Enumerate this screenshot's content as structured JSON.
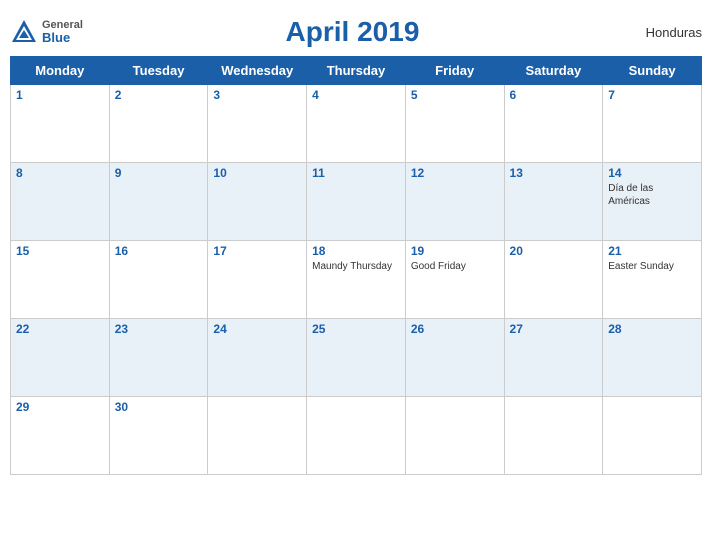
{
  "header": {
    "logo": {
      "general": "General",
      "blue": "Blue"
    },
    "title": "April 2019",
    "country": "Honduras"
  },
  "weekdays": [
    "Monday",
    "Tuesday",
    "Wednesday",
    "Thursday",
    "Friday",
    "Saturday",
    "Sunday"
  ],
  "weeks": [
    [
      {
        "date": "1",
        "holiday": ""
      },
      {
        "date": "2",
        "holiday": ""
      },
      {
        "date": "3",
        "holiday": ""
      },
      {
        "date": "4",
        "holiday": ""
      },
      {
        "date": "5",
        "holiday": ""
      },
      {
        "date": "6",
        "holiday": ""
      },
      {
        "date": "7",
        "holiday": ""
      }
    ],
    [
      {
        "date": "8",
        "holiday": ""
      },
      {
        "date": "9",
        "holiday": ""
      },
      {
        "date": "10",
        "holiday": ""
      },
      {
        "date": "11",
        "holiday": ""
      },
      {
        "date": "12",
        "holiday": ""
      },
      {
        "date": "13",
        "holiday": ""
      },
      {
        "date": "14",
        "holiday": "Día de las Américas"
      }
    ],
    [
      {
        "date": "15",
        "holiday": ""
      },
      {
        "date": "16",
        "holiday": ""
      },
      {
        "date": "17",
        "holiday": ""
      },
      {
        "date": "18",
        "holiday": "Maundy Thursday"
      },
      {
        "date": "19",
        "holiday": "Good Friday"
      },
      {
        "date": "20",
        "holiday": ""
      },
      {
        "date": "21",
        "holiday": "Easter Sunday"
      }
    ],
    [
      {
        "date": "22",
        "holiday": ""
      },
      {
        "date": "23",
        "holiday": ""
      },
      {
        "date": "24",
        "holiday": ""
      },
      {
        "date": "25",
        "holiday": ""
      },
      {
        "date": "26",
        "holiday": ""
      },
      {
        "date": "27",
        "holiday": ""
      },
      {
        "date": "28",
        "holiday": ""
      }
    ],
    [
      {
        "date": "29",
        "holiday": ""
      },
      {
        "date": "30",
        "holiday": ""
      },
      {
        "date": "",
        "holiday": ""
      },
      {
        "date": "",
        "holiday": ""
      },
      {
        "date": "",
        "holiday": ""
      },
      {
        "date": "",
        "holiday": ""
      },
      {
        "date": "",
        "holiday": ""
      }
    ]
  ]
}
